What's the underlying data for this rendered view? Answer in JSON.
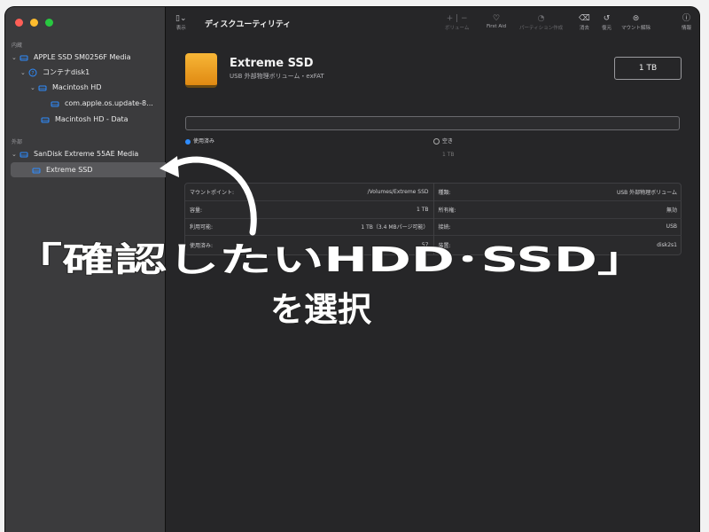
{
  "sidebar": {
    "section_internal": "内蔵",
    "section_external": "外部",
    "items": [
      {
        "label": "APPLE SSD SM0256F Media",
        "icon": "drive-icon"
      },
      {
        "label": "コンテナdisk1",
        "icon": "container-icon"
      },
      {
        "label": "Macintosh HD",
        "icon": "drive-icon"
      },
      {
        "label": "com.apple.os.update-8...",
        "icon": "drive-icon"
      },
      {
        "label": "Macintosh HD - Data",
        "icon": "drive-icon"
      },
      {
        "label": "SanDisk Extreme 55AE Media",
        "icon": "drive-icon"
      },
      {
        "label": "Extreme SSD",
        "icon": "drive-icon"
      }
    ],
    "eject": "⏏"
  },
  "toolbar": {
    "view_label": "表示",
    "title": "ディスクユーティリティ",
    "buttons": [
      {
        "label": "ボリューム",
        "glyph": "+ | −"
      },
      {
        "label": "First Aid",
        "glyph": "♡"
      },
      {
        "label": "パーティション作成",
        "glyph": "◔"
      },
      {
        "label": "消去",
        "glyph": "⌫"
      },
      {
        "label": "復元",
        "glyph": "↺"
      },
      {
        "label": "マウント解除",
        "glyph": "⊜"
      },
      {
        "label": "情報",
        "glyph": "ⓘ"
      }
    ]
  },
  "disk": {
    "name": "Extreme SSD",
    "subtitle": "USB 外部物理ボリューム・exFAT",
    "capacity": "1 TB"
  },
  "usage": {
    "used_label": "使用済み",
    "free_label": "空き",
    "free_value": "1 TB"
  },
  "info_left": [
    {
      "k": "マウントポイント:",
      "v": "/Volumes/Extreme SSD"
    },
    {
      "k": "容量:",
      "v": "1 TB"
    },
    {
      "k": "利用可能:",
      "v": "1 TB（3.4 MBパージ可能）"
    },
    {
      "k": "使用済み:",
      "v": "57"
    }
  ],
  "info_right": [
    {
      "k": "種類:",
      "v": "USB 外部物理ボリューム"
    },
    {
      "k": "所有権:",
      "v": "無効"
    },
    {
      "k": "接続:",
      "v": "USB"
    },
    {
      "k": "装置:",
      "v": "disk2s1"
    }
  ],
  "overlay": {
    "line1": "「確認したいHDD･SSD」",
    "line2": "を選択"
  },
  "colors": {
    "window_bg": "#1f1f21",
    "sidebar_bg": "#3b3b3d",
    "accent": "#2e8cff",
    "disk_orange": "#f2a22a"
  }
}
